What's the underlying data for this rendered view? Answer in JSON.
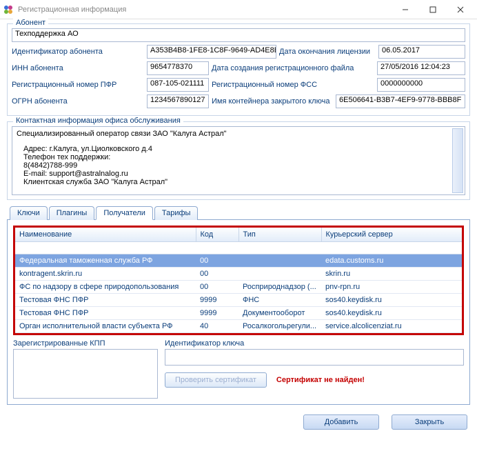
{
  "window": {
    "title": "Регистрационная информация"
  },
  "subscriber": {
    "legend": "Абонент",
    "name": "Техподдержка АО",
    "id_label": "Идентификатор абонента",
    "id_value": "A353B4B8-1FE8-1C8F-9649-AD4E8B",
    "license_end_label": "Дата окончания лицензии",
    "license_end_value": "06.05.2017",
    "inn_label": "ИНН абонента",
    "inn_value": "9654778370",
    "reg_file_date_label": "Дата создания регистрационного файла",
    "reg_file_date_value": "27/05/2016 12:04:23",
    "pfr_label": "Регистрационный номер ПФР",
    "pfr_value": "087-105-021111",
    "fss_label": "Регистрационный номер ФСС",
    "fss_value": "0000000000",
    "ogrn_label": "ОГРН абонента",
    "ogrn_value": "1234567890127",
    "container_label": "Имя контейнера закрытого ключа",
    "container_value": "6E506641-B3B7-4EF9-9778-BBB8F"
  },
  "contact": {
    "legend": "Контактная информация офиса обслуживания",
    "line1": "Специализированный оператор связи ЗАО \"Калуга Астрал\"",
    "line2": "Адрес: г.Калуга, ул.Циолковского д.4",
    "line3": "Телефон тех поддержки:",
    "line4": "8(4842)788-999",
    "line5": "E-mail: support@astralnalog.ru",
    "line6": "Клиентская служба ЗАО \"Калуга Астрал\""
  },
  "tabs": {
    "t1": "Ключи",
    "t2": "Плагины",
    "t3": "Получатели",
    "t4": "Тарифы"
  },
  "table": {
    "headers": {
      "name": "Наименование",
      "code": "Код",
      "type": "Тип",
      "server": "Курьерский сервер"
    },
    "rows": [
      {
        "name": "Федеральная таможенная служба РФ",
        "code": "00",
        "type": "",
        "server": "edata.customs.ru"
      },
      {
        "name": "kontragent.skrin.ru",
        "code": "00",
        "type": "",
        "server": "skrin.ru"
      },
      {
        "name": "ФС по надзору в сфере природопользования",
        "code": "00",
        "type": "Росприроднадзор (...",
        "server": "pnv-rpn.ru"
      },
      {
        "name": "Тестовая ФНС ПФР",
        "code": "9999",
        "type": "ФНС",
        "server": "sos40.keydisk.ru"
      },
      {
        "name": "Тестовая ФНС ПФР",
        "code": "9999",
        "type": "Документооборот",
        "server": "sos40.keydisk.ru"
      },
      {
        "name": "Орган исполнительной власти субъекта РФ",
        "code": "40",
        "type": "Росалкогольрегули...",
        "server": "service.alcolicenziat.ru"
      }
    ]
  },
  "bottom": {
    "kpp_label": "Зарегистрированные КПП",
    "key_id_label": "Идентификатор ключа",
    "check_cert_btn": "Проверить сертификат",
    "cert_warning": "Сертификат не найден!"
  },
  "footer": {
    "add": "Добавить",
    "close": "Закрыть"
  }
}
